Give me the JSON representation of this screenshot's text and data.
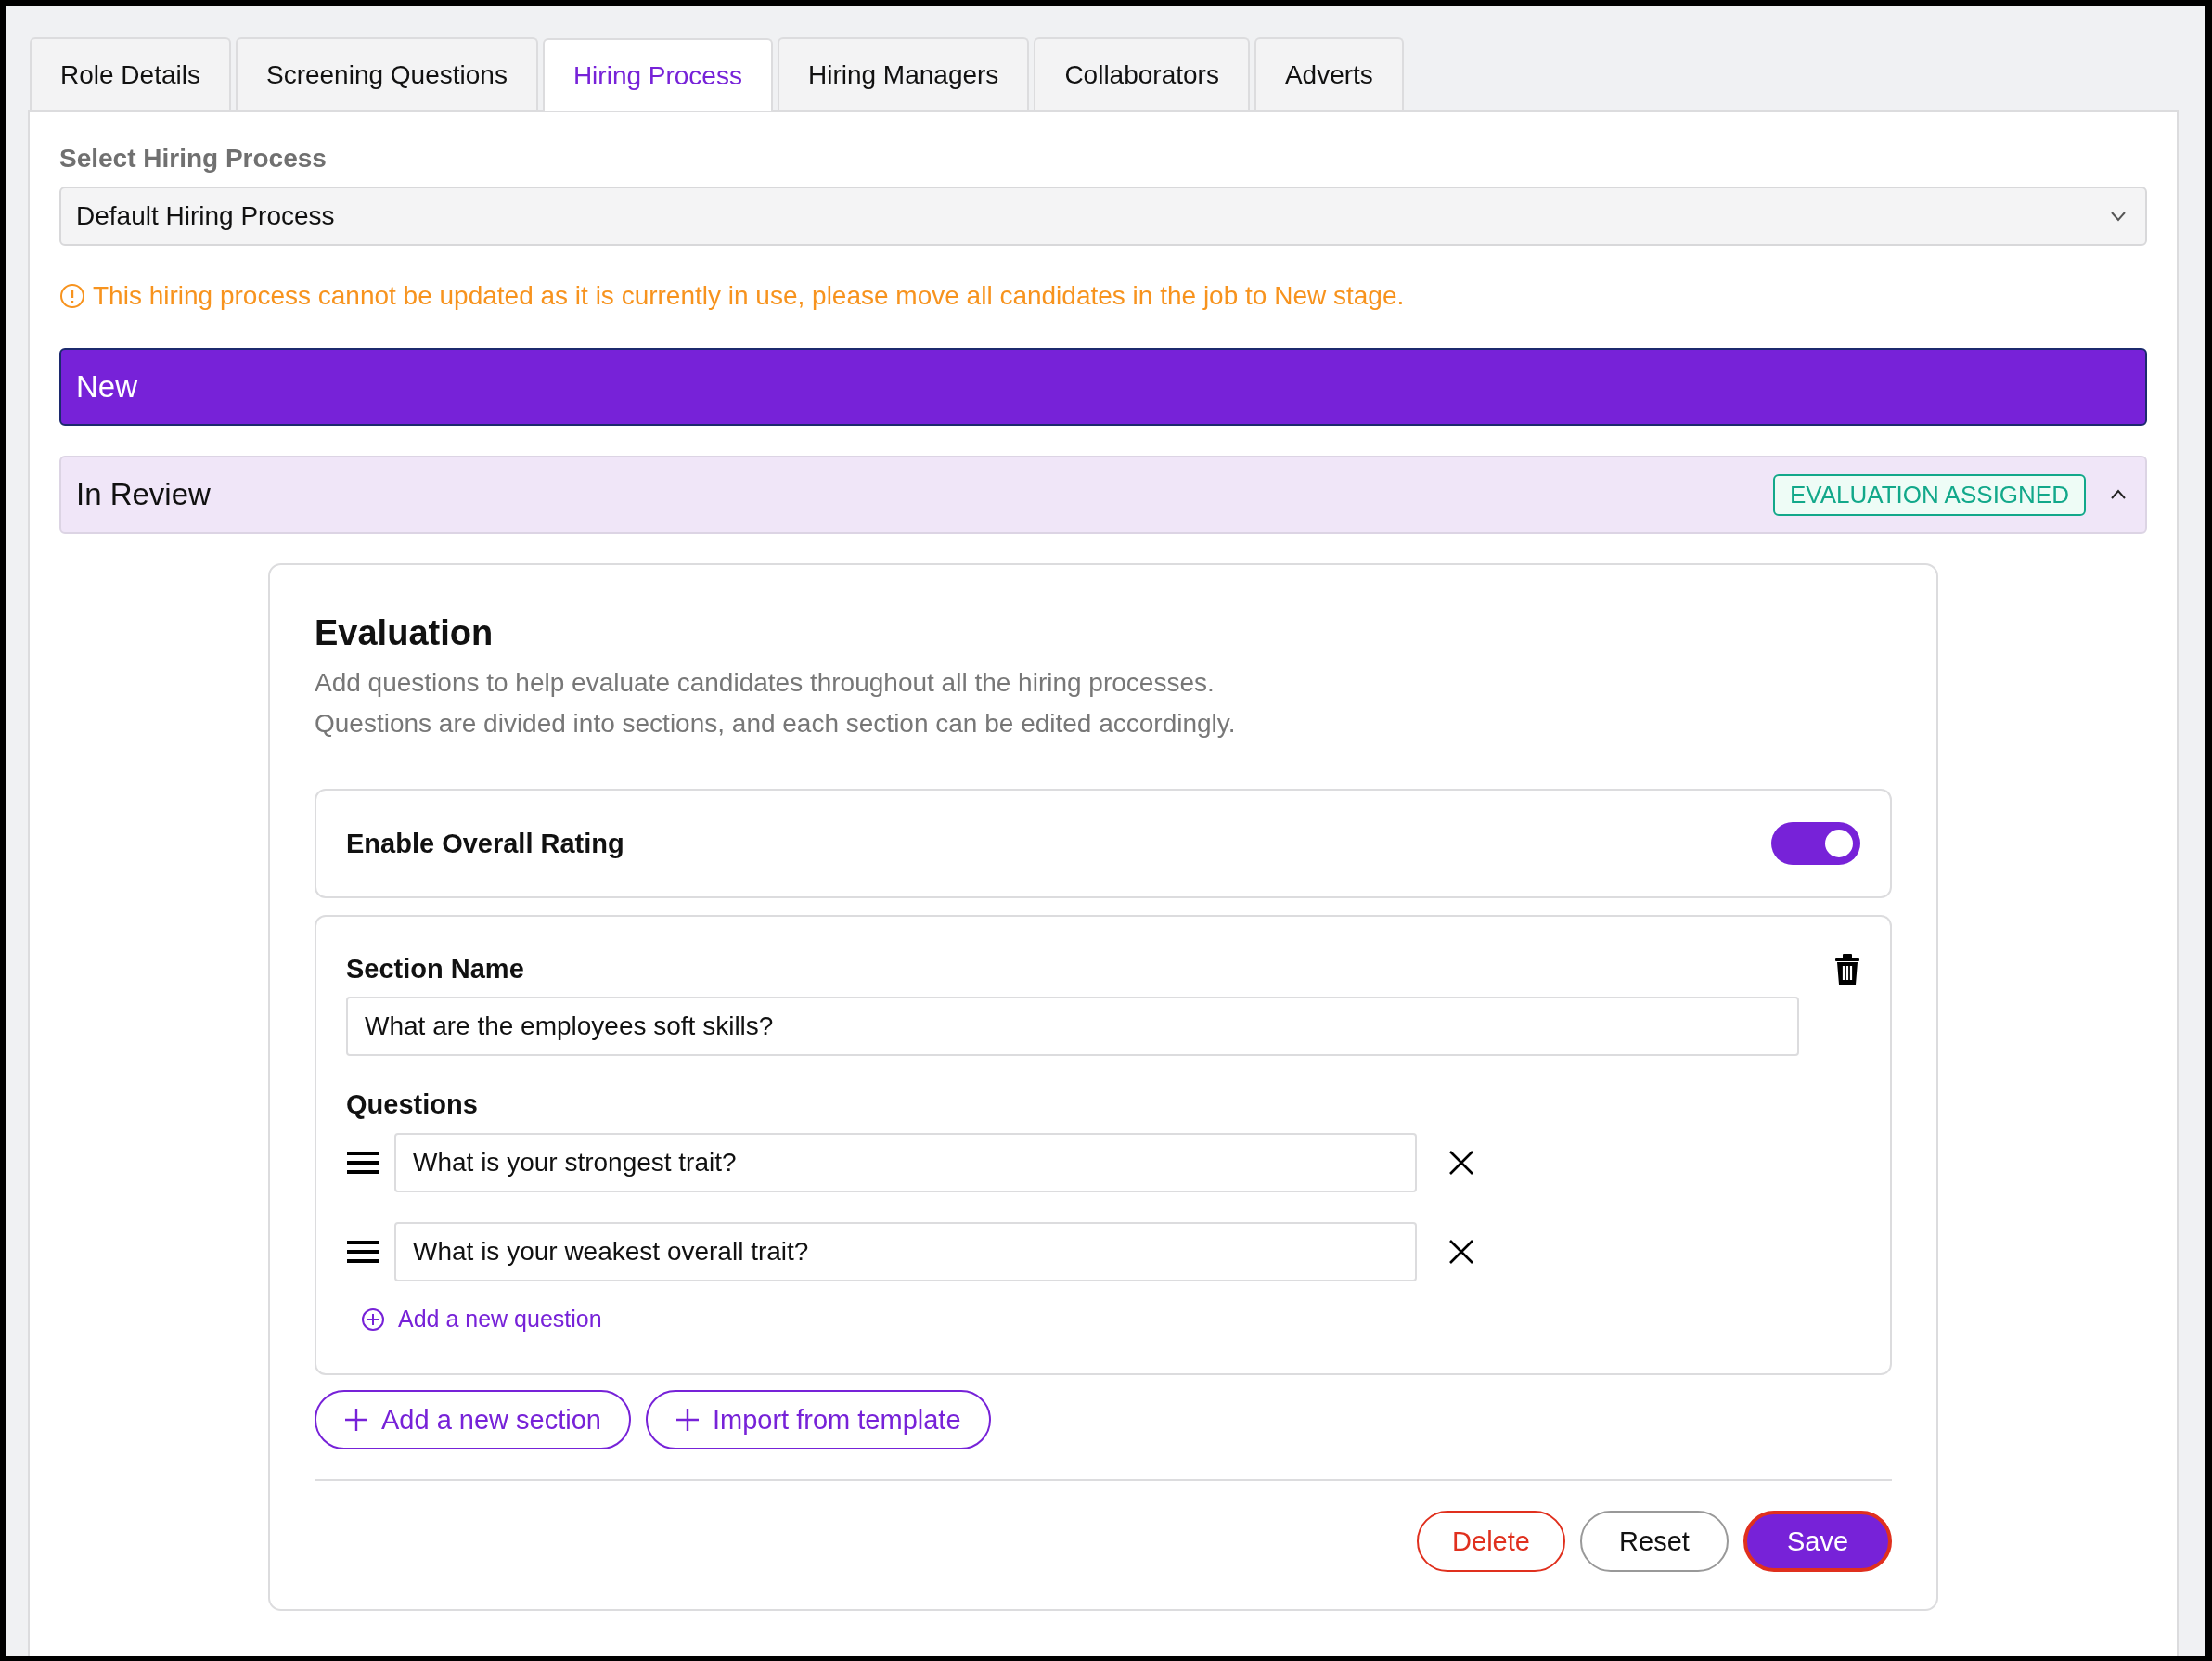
{
  "tabs": [
    {
      "label": "Role Details",
      "selected": false
    },
    {
      "label": "Screening Questions",
      "selected": false
    },
    {
      "label": "Hiring Process",
      "selected": true
    },
    {
      "label": "Hiring Managers",
      "selected": false
    },
    {
      "label": "Collaborators",
      "selected": false
    },
    {
      "label": "Adverts",
      "selected": false
    }
  ],
  "process_select": {
    "label": "Select Hiring Process",
    "value": "Default Hiring Process"
  },
  "warning": "This hiring process cannot be updated as it is currently in use, please move all candidates in the job to New stage.",
  "stages": [
    {
      "name": "New",
      "selected": true
    },
    {
      "name": "In Review",
      "selected": false,
      "badge": "EVALUATION ASSIGNED",
      "expanded": true
    }
  ],
  "evaluation": {
    "title": "Evaluation",
    "description": [
      "Add questions to help evaluate candidates throughout all the hiring processes.",
      "Questions are divided into sections, and each section can be edited accordingly."
    ],
    "overall_rating": {
      "label": "Enable Overall Rating",
      "on": true
    },
    "sections": [
      {
        "label": "Section Name",
        "value": "What are the employees soft skills?",
        "questions_label": "Questions",
        "questions": [
          "What is your strongest trait?",
          "What is your weakest overall trait?"
        ],
        "add_question": "Add a new question"
      }
    ],
    "add_section": "Add a new section",
    "import": "Import from template"
  },
  "actions": [
    {
      "label": "Delete",
      "kind": "danger"
    },
    {
      "label": "Reset",
      "kind": "default"
    },
    {
      "label": "Save",
      "kind": "primary"
    }
  ]
}
